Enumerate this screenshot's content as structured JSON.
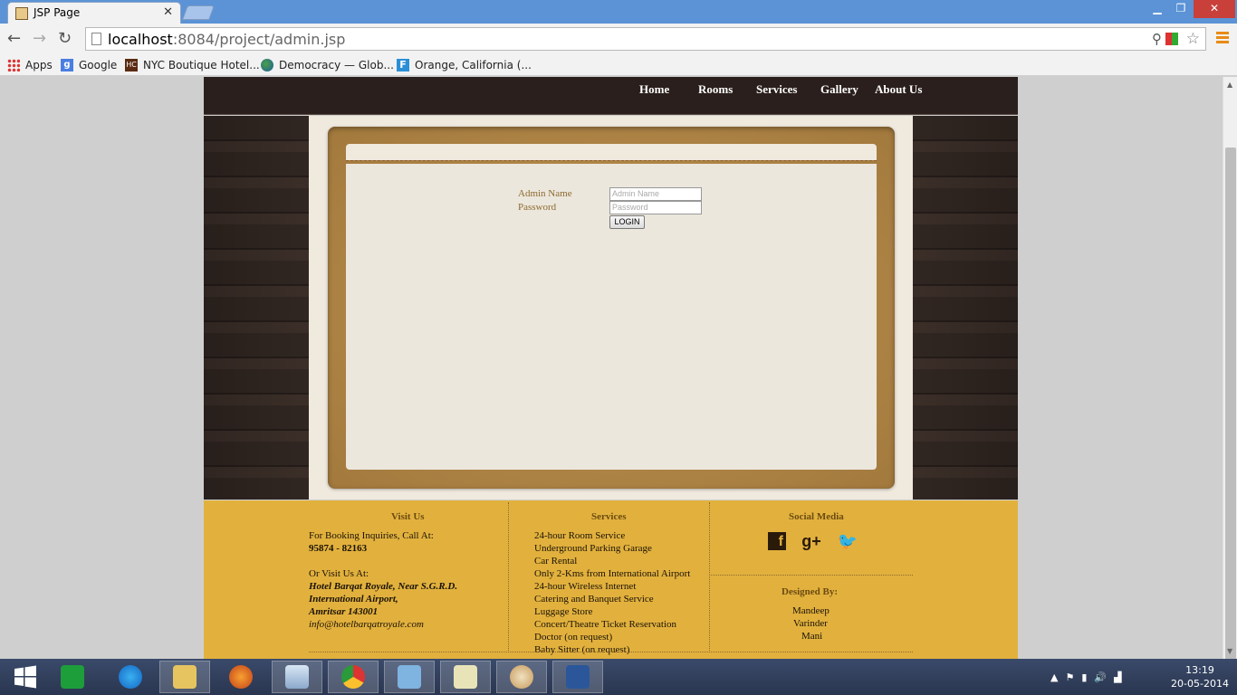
{
  "browser": {
    "tab_title": "JSP Page",
    "url_host": "localhost",
    "url_rest": ":8084/project/admin.jsp",
    "bookmarks": [
      "Apps",
      "Google",
      "NYC Boutique Hotel...",
      "Democracy — Glob...",
      "Orange, California (..."
    ]
  },
  "site": {
    "menu": [
      "Home",
      "Rooms",
      "Services",
      "Gallery",
      "About Us"
    ],
    "login": {
      "admin_label": "Admin Name",
      "password_label": "Password",
      "admin_placeholder": "Admin Name",
      "password_placeholder": "Password",
      "button": "LOGIN"
    },
    "footer": {
      "visit": {
        "title": "Visit Us",
        "booking": "For Booking Inquiries, Call At:",
        "phone": "95874 - 82163",
        "or_visit": "Or Visit Us At:",
        "addr1": "Hotel Barqat Royale, Near S.G.R.D.",
        "addr2": "International Airport,",
        "addr3": "Amritsar 143001",
        "email": "info@hotelbarqatroyale.com"
      },
      "services": {
        "title": "Services",
        "items": [
          "24-hour Room Service",
          "Underground Parking Garage",
          "Car Rental",
          "Only 2-Kms from International Airport",
          "24-hour Wireless Internet",
          "Catering and Banquet Service",
          "Luggage Store",
          "Concert/Theatre Ticket Reservation",
          "Doctor (on request)",
          "Baby Sitter (on request)"
        ]
      },
      "social": {
        "title": "Social Media",
        "icons": [
          "facebook-icon",
          "google-plus-icon",
          "twitter-icon"
        ]
      },
      "designed": {
        "title": "Designed By:",
        "names": [
          "Mandeep",
          "Varinder",
          "Mani"
        ]
      }
    }
  },
  "taskbar": {
    "time": "13:19",
    "date": "20-05-2014"
  },
  "colors": {
    "header": "#2a1f1c",
    "footer": "#e2b13d",
    "frame": "#b98a45",
    "chrome": "#5b93d6"
  }
}
